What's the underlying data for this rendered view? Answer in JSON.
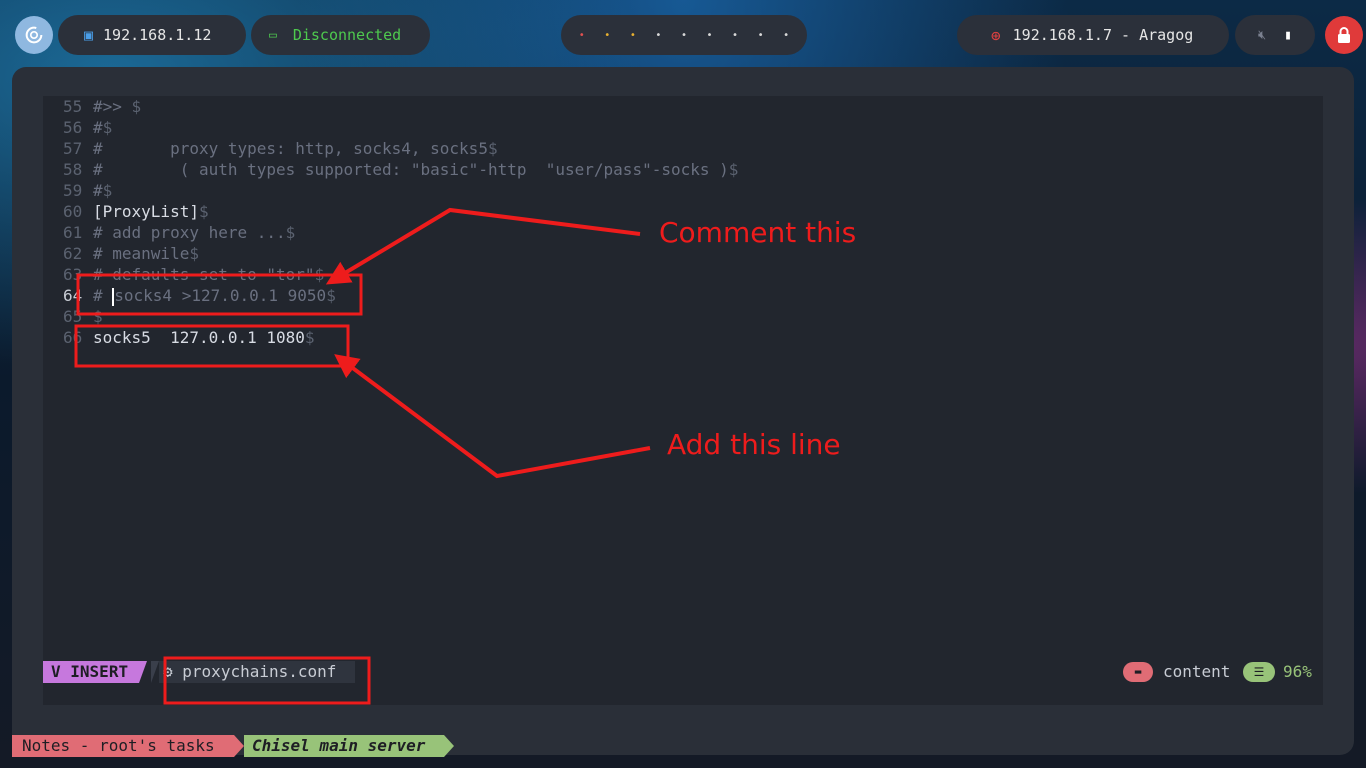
{
  "topbar": {
    "logo_icon": "debian-swirl-icon",
    "local_ip": "192.168.1.12",
    "vpn_status": "Disconnected",
    "workspaces": [
      "•",
      "•",
      "•",
      "•",
      "•",
      "•",
      "•",
      "•",
      "•"
    ],
    "workspace_colors": [
      "#e05050",
      "#e8b030",
      "#e8b030",
      "#d8d8d8",
      "#d8d8d8",
      "#d8d8d8",
      "#d8d8d8",
      "#d8d8d8",
      "#d8d8d8"
    ],
    "target": "192.168.1.7 - Aragog",
    "volume_icon": "speaker-muted-icon",
    "battery_icon": "battery-icon",
    "lock_icon": "lock-icon"
  },
  "editor": {
    "lines": [
      {
        "num": "55",
        "text": "#>> ",
        "eol": "$",
        "style": "dim"
      },
      {
        "num": "56",
        "text": "#",
        "eol": "$",
        "style": "dim"
      },
      {
        "num": "57",
        "text": "#       proxy types: http, socks4, socks5",
        "eol": "$",
        "style": "dim"
      },
      {
        "num": "58",
        "text": "#        ( auth types supported: \"basic\"-http  \"user/pass\"-socks )",
        "eol": "$",
        "style": "dim"
      },
      {
        "num": "59",
        "text": "#",
        "eol": "$",
        "style": "dim"
      },
      {
        "num": "60",
        "text": "[ProxyList]",
        "eol": "$",
        "style": "bright"
      },
      {
        "num": "61",
        "text": "# add proxy here ...",
        "eol": "$",
        "style": "dim"
      },
      {
        "num": "62",
        "text": "# meanwile",
        "eol": "$",
        "style": "dim"
      },
      {
        "num": "63",
        "text": "# defaults set to \"tor\"",
        "eol": "$",
        "style": "dim"
      },
      {
        "num": "64",
        "text": "socks4 >127.0.0.1 9050",
        "eol": "$",
        "style": "dim",
        "prefix": "# "
      },
      {
        "num": "65",
        "text": "",
        "eol": "$",
        "style": "dim"
      },
      {
        "num": "66",
        "text": "socks5  127.0.0.1 1080",
        "eol": "$",
        "style": "bright"
      }
    ]
  },
  "statusline": {
    "mode": "INSERT",
    "mode_icon": "vim-icon",
    "file_icon": "gear-icon",
    "filename": "proxychains.conf",
    "folder_icon": "folder-icon",
    "directory": "content",
    "lines_icon": "lines-icon",
    "percent": "96%"
  },
  "tmux": {
    "tab1": "Notes - root's tasks",
    "tab2": "Chisel main server"
  },
  "annotations": {
    "comment_label": "Comment this",
    "add_label": "Add this line",
    "color": "#ee1c1c"
  }
}
